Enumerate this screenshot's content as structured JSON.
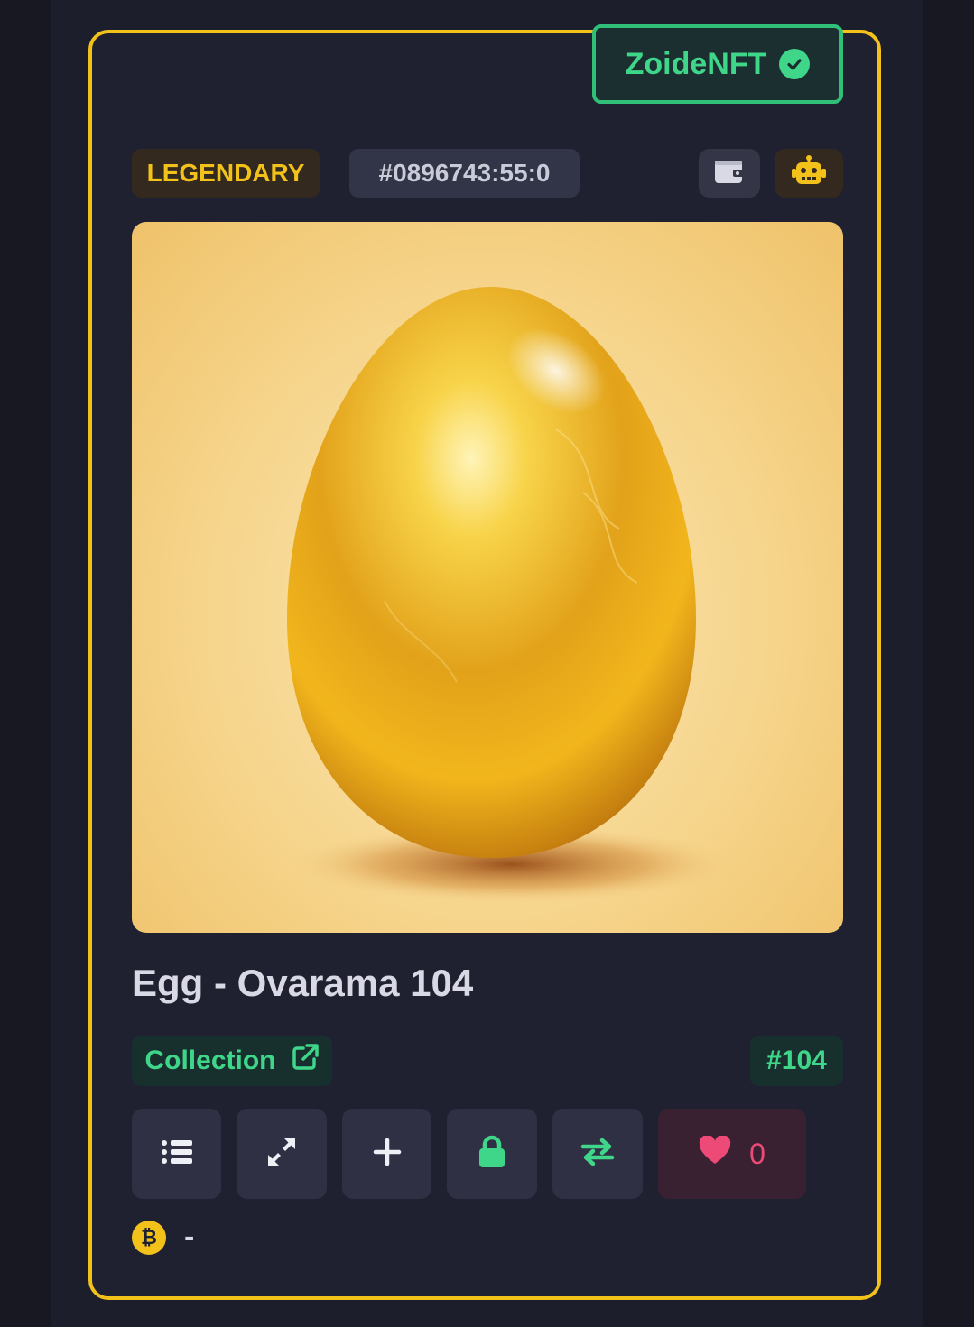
{
  "owner_badge": {
    "label": "ZoideNFT",
    "verified_icon": "check-circle-icon"
  },
  "rarity": "LEGENDARY",
  "inscription_id": "#0896743:55:0",
  "header_icons": [
    "wallet-icon",
    "robot-icon"
  ],
  "artwork": {
    "subject": "golden egg",
    "icon": "egg-artwork"
  },
  "title": "Egg - Ovarama 104",
  "collection": {
    "label": "Collection",
    "icon": "external-link-icon"
  },
  "number": "#104",
  "actions": [
    {
      "name": "details",
      "icon": "list-icon"
    },
    {
      "name": "expand",
      "icon": "expand-icon"
    },
    {
      "name": "add",
      "icon": "plus-icon"
    },
    {
      "name": "lock",
      "icon": "lock-icon"
    },
    {
      "name": "transfer",
      "icon": "swap-icon"
    },
    {
      "name": "like",
      "icon": "heart-icon",
      "count": "0"
    }
  ],
  "price": {
    "currency_icon": "bitcoin-icon",
    "value": "-"
  },
  "colors": {
    "accent_gold": "#f2c21b",
    "accent_green": "#3fd68a",
    "heart_pink": "#ee4a77",
    "card_bg": "#1f2030"
  }
}
